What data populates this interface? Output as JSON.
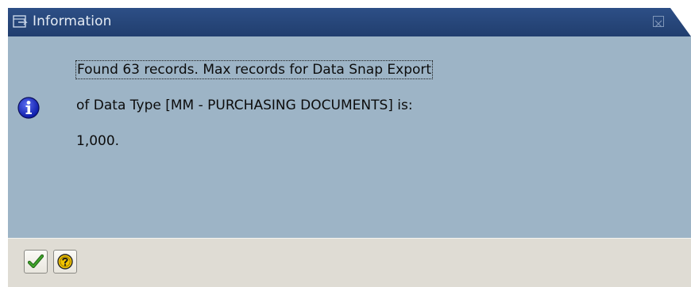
{
  "dialog": {
    "title": "Information",
    "message_lines": [
      "Found 63 records. Max records for Data Snap Export",
      "of Data Type [MM - PURCHASING DOCUMENTS] is:",
      "1,000."
    ]
  },
  "icons": {
    "title": "dialog-window-icon",
    "message": "info-icon",
    "close": "close-icon",
    "ok": "checkmark-icon",
    "help": "help-question-icon"
  },
  "colors": {
    "title_bar": "#2d4f86",
    "body": "#9db4c6",
    "footer": "#dfdcd4",
    "check": "#2e8b1e",
    "help": "#f2c400"
  }
}
